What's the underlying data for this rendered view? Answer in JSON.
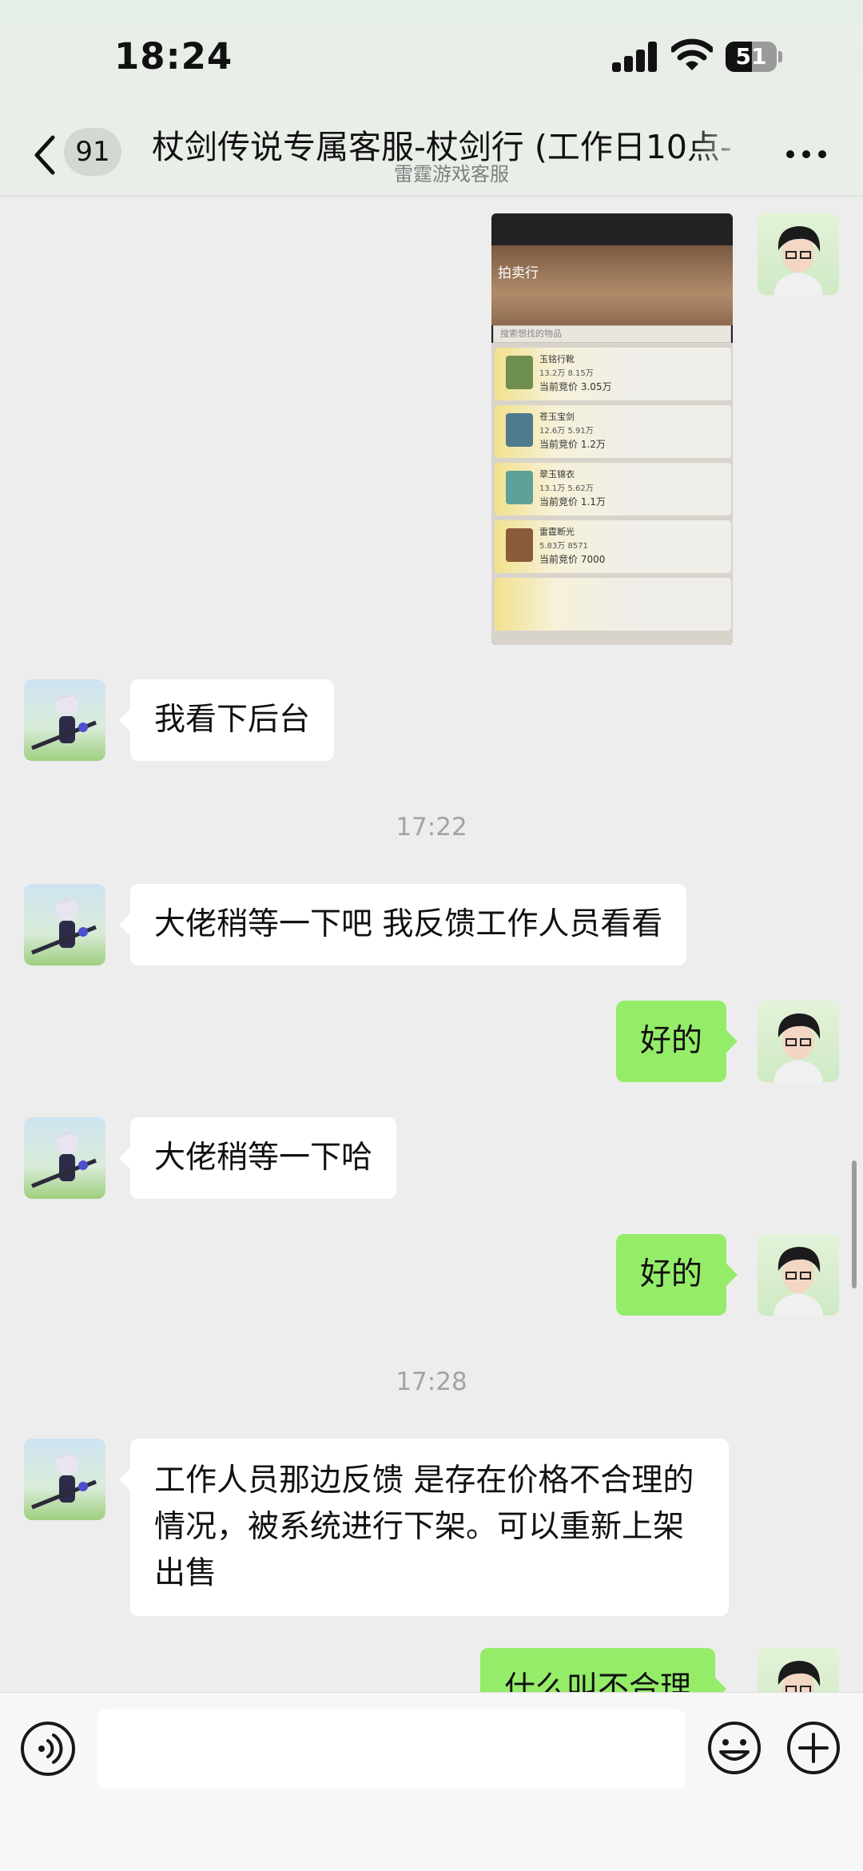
{
  "status_bar": {
    "time": "18:24",
    "battery_level": "51"
  },
  "nav": {
    "unread_count": "91",
    "title": "杖剑传说专属客服-杖剑行 (工作日10点-",
    "subtitle": "雷霆游戏客服"
  },
  "shot": {
    "title": "拍卖行",
    "search_placeholder": "搜索想找的物品",
    "rows": [
      {
        "name": "玉铭行靴",
        "stats": "13.2万 8.15万",
        "price": "当前竞价 3.05万"
      },
      {
        "name": "苍玉宝剑",
        "stats": "12.6万 5.91万",
        "price": "当前竞价 1.2万"
      },
      {
        "name": "翠玉锦衣",
        "stats": "13.1万 5.62万",
        "price": "当前竞价 1.1万"
      },
      {
        "name": "雷霆断光",
        "stats": "5.83万 8571",
        "price": "当前竞价 7000"
      }
    ]
  },
  "messages": [
    {
      "text": "我看下后台"
    },
    {
      "time": "17:22"
    },
    {
      "text": "大佬稍等一下吧 我反馈工作人员看看"
    },
    {
      "text": "好的"
    },
    {
      "text": "大佬稍等一下哈"
    },
    {
      "text": "好的"
    },
    {
      "time": "17:28"
    },
    {
      "text": "工作人员那边反馈 是存在价格不合理的情况，被系统进行下架。可以重新上架出售"
    },
    {
      "text": "什么叫不合理"
    }
  ],
  "colors": {
    "outgoing_bubble": "#95ec69",
    "incoming_bubble": "#ffffff",
    "chat_background": "#ededed"
  },
  "icons": [
    "back-icon",
    "more-icon",
    "voice-icon",
    "emoji-icon",
    "plus-icon",
    "signal-icon",
    "wifi-icon",
    "battery-icon"
  ]
}
